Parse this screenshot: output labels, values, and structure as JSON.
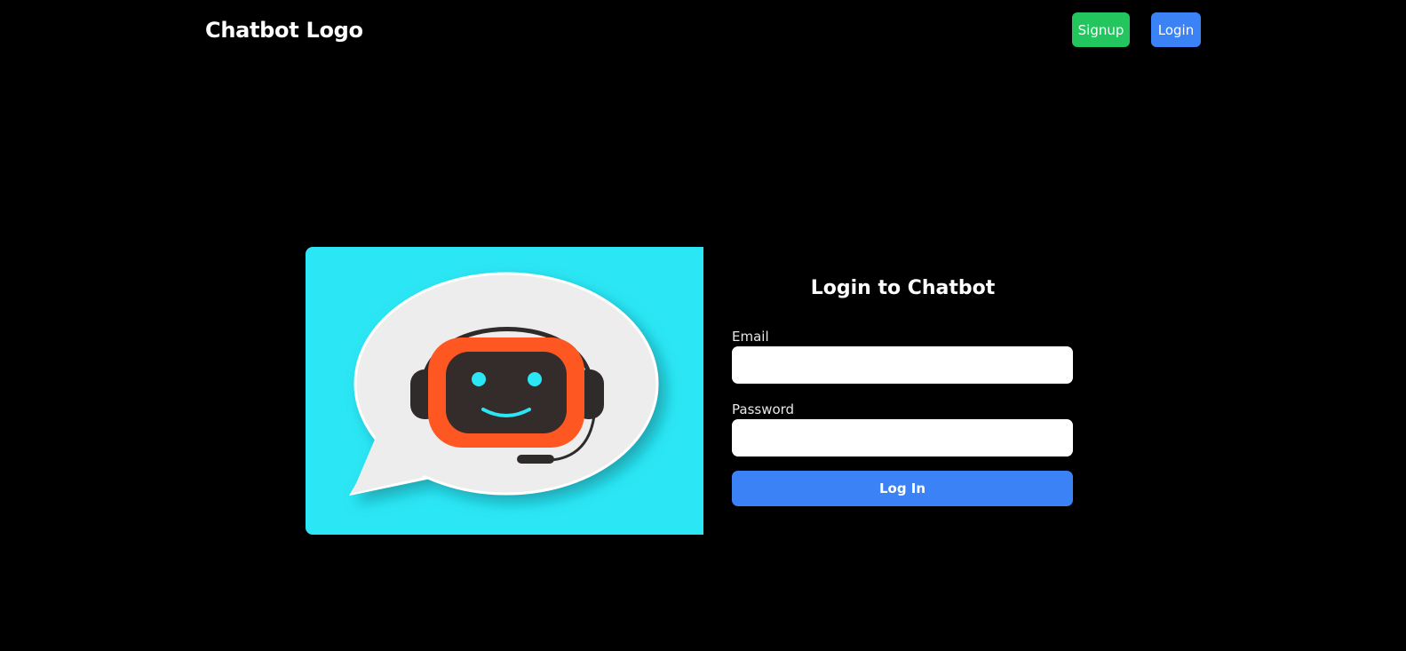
{
  "header": {
    "logo_text": "Chatbot Logo",
    "signup_label": "Signup",
    "login_label": "Login"
  },
  "illustration": {
    "icon": "chatbot-speech-bubble-icon",
    "background_color": "#2be6f4",
    "face_color": "#ff5722"
  },
  "login_form": {
    "title": "Login to Chatbot",
    "email_label": "Email",
    "email_value": "",
    "password_label": "Password",
    "password_value": "",
    "submit_label": "Log In"
  },
  "colors": {
    "signup_button": "#22c55e",
    "login_button": "#3b82f6",
    "submit_button": "#3b82f6",
    "page_background": "#000000"
  }
}
